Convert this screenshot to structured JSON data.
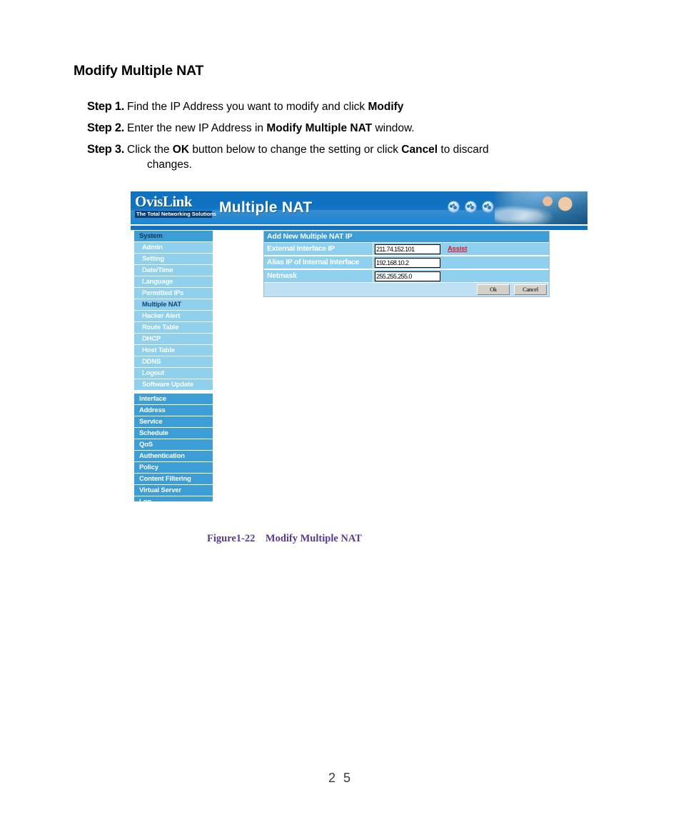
{
  "document": {
    "title": "Modify Multiple NAT",
    "steps": [
      {
        "label": "Step 1.",
        "parts": [
          {
            "text": "Find the IP Address you want to modify and click ",
            "bold": false
          },
          {
            "text": "Modify",
            "bold": true
          }
        ]
      },
      {
        "label": "Step 2.",
        "parts": [
          {
            "text": "Enter the new IP Address in ",
            "bold": false
          },
          {
            "text": "Modify Multiple NAT",
            "bold": true
          },
          {
            "text": " window.",
            "bold": false
          }
        ]
      },
      {
        "label": "Step 3.",
        "parts": [
          {
            "text": "Click the ",
            "bold": false
          },
          {
            "text": "OK",
            "bold": true
          },
          {
            "text": " button below to change the setting or click ",
            "bold": false
          },
          {
            "text": "Cancel",
            "bold": true
          },
          {
            "text": " to discard",
            "bold": false
          }
        ],
        "continuation": "changes."
      }
    ],
    "figure_caption": "Figure1-22    Modify Multiple NAT",
    "page_number": "2 5"
  },
  "screenshot": {
    "banner": {
      "logo_word": "OvisLink",
      "logo_tagline": "The Total Networking Solutions",
      "title": "Multiple NAT",
      "globe_icons": [
        "globe-icon",
        "globe-icon",
        "globe-icon"
      ],
      "photo_alt": "people-at-computer-photo"
    },
    "sidebar": {
      "sections": [
        {
          "label": "System",
          "active": true,
          "items": [
            {
              "label": "Admin",
              "active": false
            },
            {
              "label": "Setting",
              "active": false
            },
            {
              "label": "Date/Time",
              "active": false
            },
            {
              "label": "Language",
              "active": false
            },
            {
              "label": "Permitted IPs",
              "active": false
            },
            {
              "label": "Multiple NAT",
              "active": true
            },
            {
              "label": "Hacker Alert",
              "active": false
            },
            {
              "label": "Route Table",
              "active": false
            },
            {
              "label": "DHCP",
              "active": false
            },
            {
              "label": "Host Table",
              "active": false
            },
            {
              "label": "DDNS",
              "active": false
            },
            {
              "label": "Logout",
              "active": false
            },
            {
              "label": "Software Update",
              "active": false
            }
          ]
        }
      ],
      "nav_items": [
        {
          "label": "Interface"
        },
        {
          "label": "Address"
        },
        {
          "label": "Service"
        },
        {
          "label": "Schedule"
        },
        {
          "label": "QoS"
        },
        {
          "label": "Authentication"
        },
        {
          "label": "Policy"
        },
        {
          "label": "Content Filtering"
        },
        {
          "label": "Virtual Server"
        },
        {
          "label": "Log"
        }
      ]
    },
    "panel": {
      "heading": "Add New Multiple NAT IP",
      "rows": [
        {
          "label": "External Interface IP",
          "value": "211.74.152.101",
          "assist": "Assist"
        },
        {
          "label": "Alias IP of Internal Interface",
          "value": "192.168.10.2",
          "assist": ""
        },
        {
          "label": "Netmask",
          "value": "255.255.255.0",
          "assist": ""
        }
      ],
      "buttons": {
        "ok": "Ok",
        "cancel": "Cancel"
      }
    },
    "colors": {
      "banner_blue": "#1173bf",
      "nav_blue": "#3d9ed6",
      "subnav_blue": "#8ed0ee",
      "panel_bg": "#bfe0f2",
      "assist_red": "#e81123",
      "active_label": "#13477d",
      "caption_purple": "#5B3A8E"
    }
  }
}
